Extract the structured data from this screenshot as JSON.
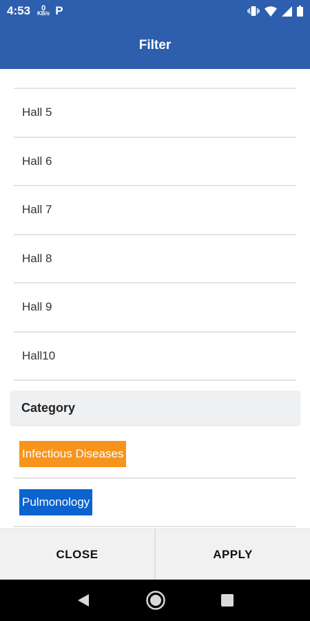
{
  "status_bar": {
    "time": "4:53",
    "speed_value": "0",
    "speed_unit": "KB/s",
    "app_letter": "P",
    "icons": [
      "vibrate-icon",
      "wifi-icon",
      "signal-icon",
      "battery-icon"
    ]
  },
  "app_bar": {
    "title": "Filter"
  },
  "halls": [
    "Hall 5",
    "Hall 6",
    "Hall 7",
    "Hall 8",
    "Hall 9",
    "Hall10"
  ],
  "category": {
    "header": "Category",
    "items": [
      {
        "label": "Infectious Diseases",
        "color": "#f7941d"
      },
      {
        "label": "Pulmonology",
        "color": "#0b63ce"
      }
    ]
  },
  "footer": {
    "close_label": "CLOSE",
    "apply_label": "APPLY"
  },
  "nav_bar": {
    "icons": [
      "back-icon",
      "home-icon",
      "recents-icon"
    ]
  },
  "colors": {
    "primary": "#2d5fae",
    "divider": "#e3e3e3",
    "footer_bg": "#f1f1f1"
  }
}
